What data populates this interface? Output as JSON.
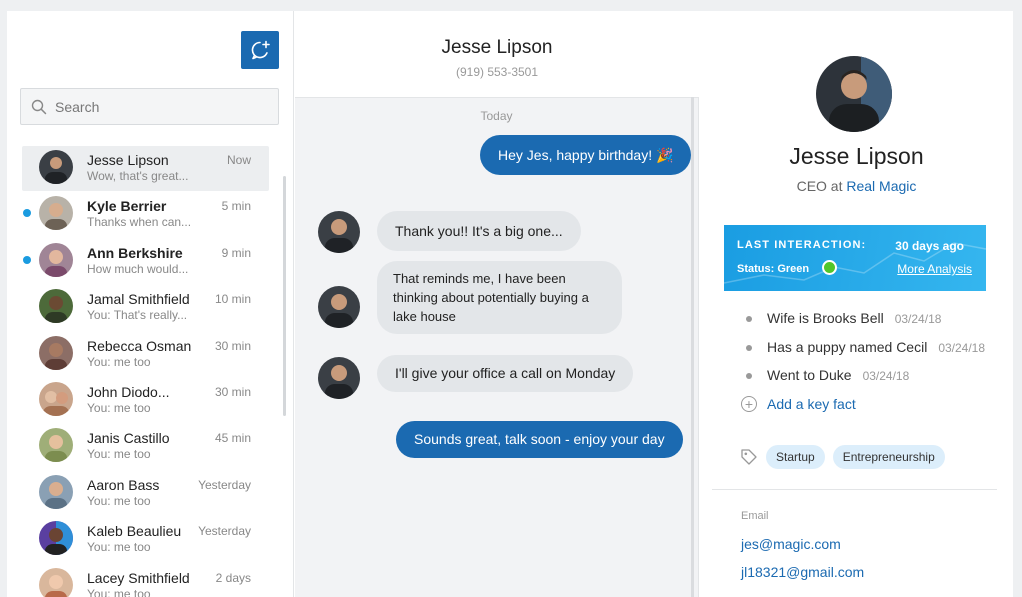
{
  "sidebar": {
    "search_placeholder": "Search",
    "conversations": [
      {
        "name": "Jesse Lipson",
        "preview": "Wow, that's great...",
        "time": "Now",
        "unread": false,
        "active": true,
        "avatar": "#3a3f45"
      },
      {
        "name": "Kyle Berrier",
        "preview": "Thanks when can...",
        "time": "5 min",
        "unread": true,
        "active": false,
        "avatar": "#6d6256"
      },
      {
        "name": "Ann Berkshire",
        "preview": "How much would...",
        "time": "9 min",
        "unread": true,
        "active": false,
        "avatar": "#7b4a6b"
      },
      {
        "name": "Jamal Smithfield",
        "preview": "You: That's really...",
        "time": "10 min",
        "unread": false,
        "active": false,
        "avatar": "#4d6a3a"
      },
      {
        "name": "Rebecca Osman",
        "preview": "You: me too",
        "time": "30 min",
        "unread": false,
        "active": false,
        "avatar": "#5e3d36"
      },
      {
        "name": "John Diodo...",
        "preview": "You: me too",
        "time": "30 min",
        "unread": false,
        "active": false,
        "avatar": "#a47152"
      },
      {
        "name": "Janis Castillo",
        "preview": "You: me too",
        "time": "45 min",
        "unread": false,
        "active": false,
        "avatar": "#7c8d4f"
      },
      {
        "name": "Aaron Bass",
        "preview": "You: me too",
        "time": "Yesterday",
        "unread": false,
        "active": false,
        "avatar": "#5b7185"
      },
      {
        "name": "Kaleb Beaulieu",
        "preview": "You: me too",
        "time": "Yesterday",
        "unread": false,
        "active": false,
        "avatar": "#5a3fa0"
      },
      {
        "name": "Lacey Smithfield",
        "preview": "You: me too",
        "time": "2 days",
        "unread": false,
        "active": false,
        "avatar": "#b86a4a"
      }
    ]
  },
  "chat": {
    "title": "Jesse Lipson",
    "phone": "(919) 553-3501",
    "day_label": "Today",
    "messages": [
      {
        "text": "Hey Jes, happy birthday! 🎉"
      },
      {
        "text": "Thank you!! It's a big one..."
      },
      {
        "text": "That reminds me, I have been thinking about potentially buying a lake house"
      },
      {
        "text": "I'll give your office a call on Monday"
      },
      {
        "text": "Sounds great, talk soon - enjoy your day"
      }
    ]
  },
  "profile": {
    "name": "Jesse Lipson",
    "role_prefix": "CEO at",
    "company": "Real Magic",
    "interaction_label": "LAST INTERACTION:",
    "interaction_value": "30 days ago",
    "status_text": "Status: Green",
    "more_analysis": "More Analysis",
    "facts": [
      {
        "text": "Wife is Brooks Bell",
        "date": "03/24/18"
      },
      {
        "text": "Has a puppy named Cecil",
        "date": "03/24/18"
      },
      {
        "text": "Went to Duke",
        "date": "03/24/18"
      }
    ],
    "add_fact_label": "Add a key fact",
    "tags": [
      "Startup",
      "Entrepreneurship"
    ],
    "email_label": "Email",
    "emails": [
      "jes@magic.com",
      "jl18321@gmail.com"
    ]
  },
  "colors": {
    "brand_blue": "#1b6ab1",
    "accent_blue": "#1a9be0",
    "status_green": "#51c62b"
  }
}
